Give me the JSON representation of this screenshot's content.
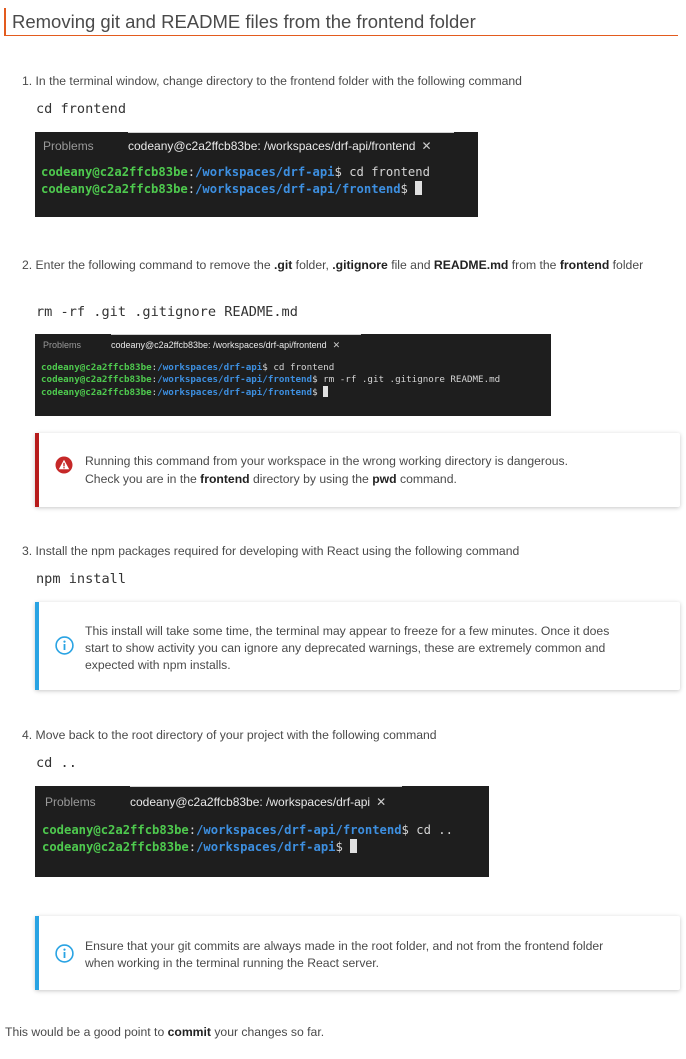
{
  "title": "Removing git and README files from the frontend folder",
  "colors": {
    "accent": "#e35b1e",
    "danger": "#b71c1c",
    "info": "#29a3e3",
    "term_user": "#4ec94e",
    "term_path": "#3d8fe0"
  },
  "step1": {
    "text": "1. In the terminal window, change directory to the frontend folder with the following command",
    "command": "cd frontend",
    "terminal": {
      "tab_problems": "Problems",
      "tab_title": "codeany@c2a2ffcb83be: /workspaces/drf-api/frontend",
      "lines": [
        {
          "user": "codeany@c2a2ffcb83be",
          "path": "/workspaces/drf-api",
          "cmd": "cd frontend"
        },
        {
          "user": "codeany@c2a2ffcb83be",
          "path": "/workspaces/drf-api/frontend",
          "cmd": ""
        }
      ]
    }
  },
  "step2": {
    "text_prefix": "2. Enter the following command to remove the ",
    "bold1": ".git",
    "text_mid1": " folder, ",
    "bold2": ".gitignore",
    "text_mid2": " file and ",
    "bold3": "README.md",
    "text_mid3": " from the ",
    "bold4": "frontend",
    "text_suffix": " folder",
    "command": "rm -rf .git .gitignore README.md",
    "terminal": {
      "tab_problems": "Problems",
      "tab_title": "codeany@c2a2ffcb83be: /workspaces/drf-api/frontend",
      "lines": [
        {
          "user": "codeany@c2a2ffcb83be",
          "path": "/workspaces/drf-api",
          "cmd": "cd frontend"
        },
        {
          "user": "codeany@c2a2ffcb83be",
          "path": "/workspaces/drf-api/frontend",
          "cmd": "rm -rf .git .gitignore README.md"
        },
        {
          "user": "codeany@c2a2ffcb83be",
          "path": "/workspaces/drf-api/frontend",
          "cmd": ""
        }
      ]
    },
    "warning": {
      "line1": "Running this command from your workspace in the wrong working directory is dangerous.",
      "line2_prefix": "Check you are in the ",
      "line2_bold1": "frontend",
      "line2_mid": " directory by using the ",
      "line2_bold2": "pwd",
      "line2_suffix": " command."
    }
  },
  "step3": {
    "text": "3. Install the npm packages required for developing with React using the following command",
    "command": "npm install",
    "info": {
      "line1": "This install will take some time, the terminal may appear to freeze for a few minutes. Once it does",
      "line2": "start to show activity you can ignore any deprecated warnings, these are extremely common and",
      "line3": "expected with npm installs."
    }
  },
  "step4": {
    "text": "4. Move back to the root directory of your project with the following command",
    "command": "cd ..",
    "terminal": {
      "tab_problems": "Problems",
      "tab_title": "codeany@c2a2ffcb83be: /workspaces/drf-api",
      "lines": [
        {
          "user": "codeany@c2a2ffcb83be",
          "path": "/workspaces/drf-api/frontend",
          "cmd": "cd .."
        },
        {
          "user": "codeany@c2a2ffcb83be",
          "path": "/workspaces/drf-api",
          "cmd": ""
        }
      ]
    },
    "info": {
      "line1": "Ensure that your git commits are always made in the root folder, and not from the frontend folder",
      "line2": "when working in the terminal running the React server."
    }
  },
  "footer": {
    "prefix": "This would be a good point to ",
    "bold": "commit",
    "suffix": " your changes so far."
  }
}
